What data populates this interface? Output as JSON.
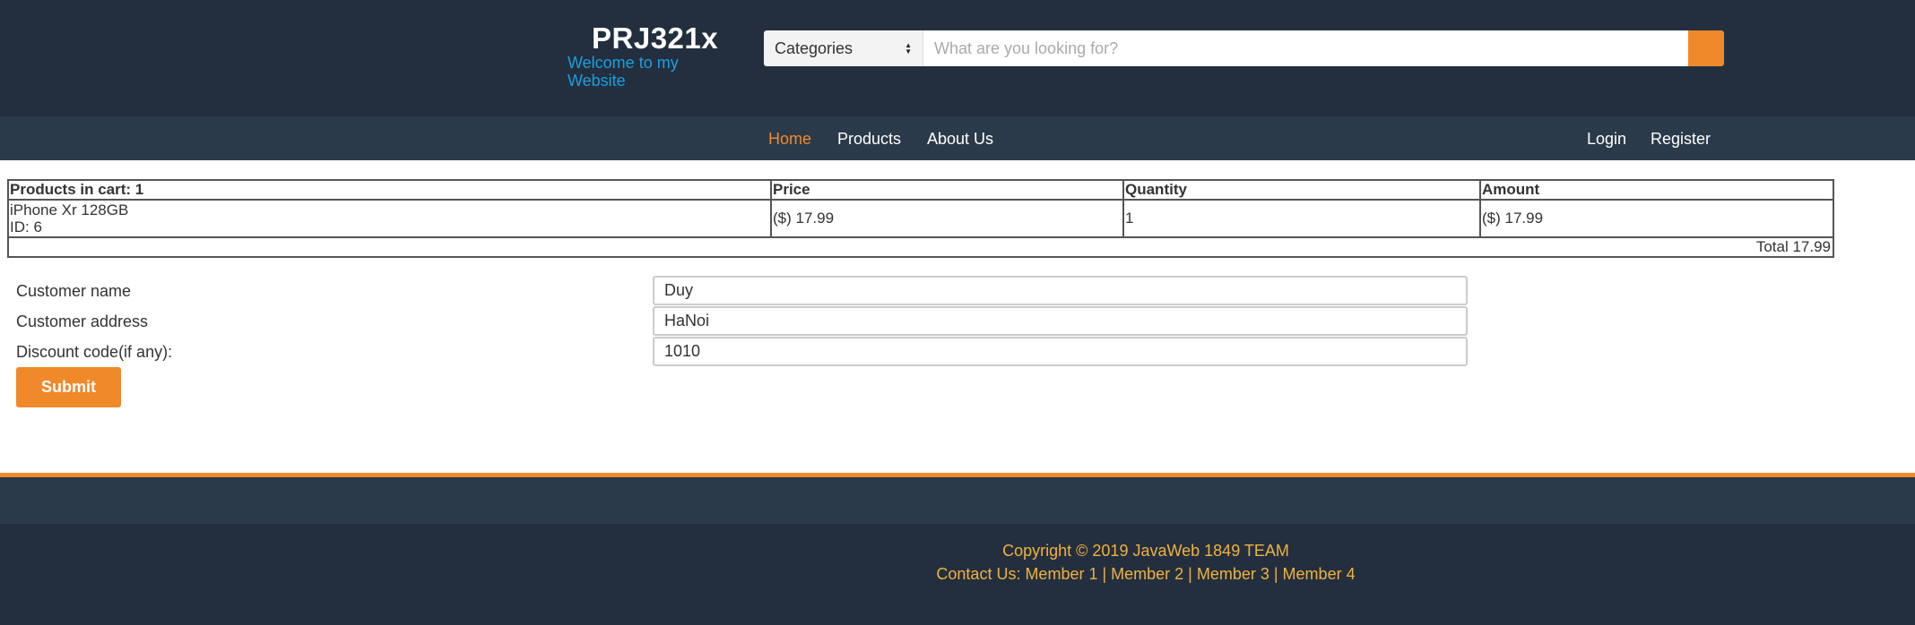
{
  "header": {
    "brand_title": "PRJ321x",
    "brand_subtitle": "Welcome to my Website",
    "categories_label": "Categories",
    "search_placeholder": "What are you looking for?"
  },
  "nav": {
    "items": [
      {
        "label": "Home",
        "active": true
      },
      {
        "label": "Products",
        "active": false
      },
      {
        "label": "About Us",
        "active": false
      }
    ],
    "login": "Login",
    "register": "Register"
  },
  "cart": {
    "headers": {
      "products": "Products in cart: 1",
      "price": "Price",
      "quantity": "Quantity",
      "amount": "Amount"
    },
    "rows": [
      {
        "name": "iPhone Xr 128GB",
        "id_label": "ID: 6",
        "price": "($) 17.99",
        "quantity": "1",
        "amount": "($) 17.99"
      }
    ],
    "total": "Total 17.99"
  },
  "form": {
    "customer_name_label": "Customer name",
    "customer_name_value": "Duy",
    "customer_address_label": "Customer address",
    "customer_address_value": "HaNoi",
    "discount_label": "Discount code(if any):",
    "discount_value": "1010",
    "submit_label": "Submit"
  },
  "footer": {
    "copyright": "Copyright © 2019 JavaWeb 1849 TEAM",
    "contact": "Contact Us: Member 1 | Member 2 | Member 3 | Member 4"
  },
  "colors": {
    "header_bg": "#232f3e",
    "nav_bg": "#2b3a4a",
    "accent": "#f0892a",
    "subtitle": "#1a9fe0",
    "footer_text": "#f0b23e"
  }
}
